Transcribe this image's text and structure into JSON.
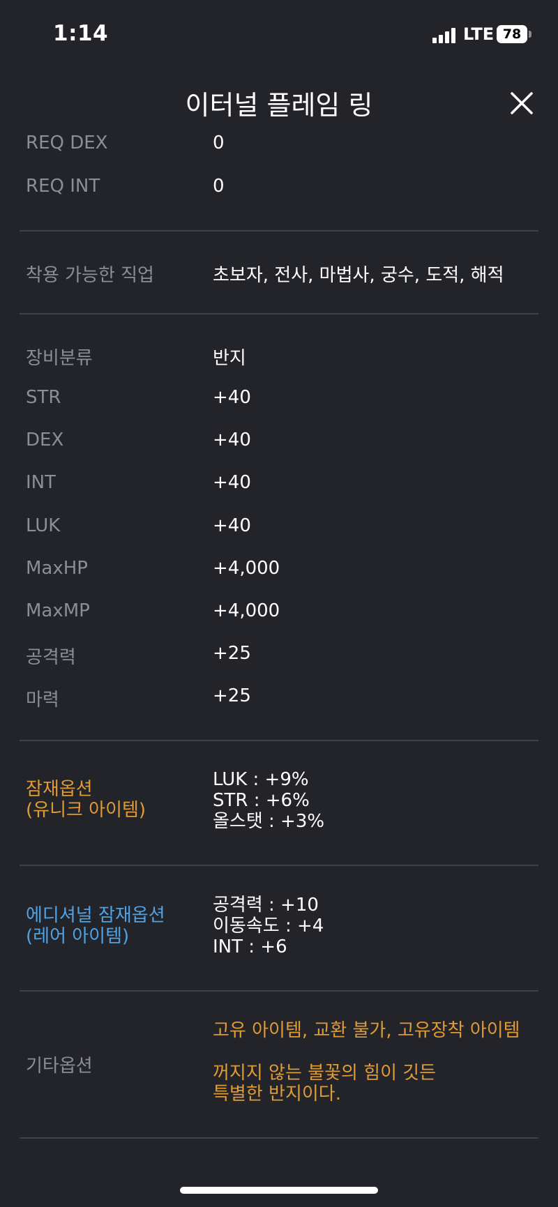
{
  "status_bar": {
    "time": "1:14",
    "network": "LTE",
    "battery": "78"
  },
  "header": {
    "title": "이터널 플레임 링",
    "close_icon": "close-icon"
  },
  "req": [
    {
      "label": "REQ DEX",
      "value": "0"
    },
    {
      "label": "REQ INT",
      "value": "0"
    }
  ],
  "jobs": {
    "label": "착용 가능한 직업",
    "value": "초보자, 전사, 마법사, 궁수, 도적, 해적"
  },
  "stats": [
    {
      "label": "장비분류",
      "value": "반지"
    },
    {
      "label": "STR",
      "value": "+40"
    },
    {
      "label": "DEX",
      "value": "+40"
    },
    {
      "label": "INT",
      "value": "+40"
    },
    {
      "label": "LUK",
      "value": "+40"
    },
    {
      "label": "MaxHP",
      "value": "+4,000"
    },
    {
      "label": "MaxMP",
      "value": "+4,000"
    },
    {
      "label": "공격력",
      "value": "+25"
    },
    {
      "label": "마력",
      "value": "+25"
    }
  ],
  "potential": {
    "label_line1": "잠재옵션",
    "label_line2": "(유니크 아이템)",
    "label_color": "#e09a36",
    "lines": [
      "LUK : +9%",
      "STR : +6%",
      "올스탯 : +3%"
    ]
  },
  "additional_potential": {
    "label_line1": "에디셔널 잠재옵션",
    "label_line2": "(레어 아이템)",
    "label_color": "#4ea3e6",
    "lines": [
      "공격력 : +10",
      "이동속도 : +4",
      "INT : +6"
    ]
  },
  "other": {
    "label": "기타옵션",
    "line1": "고유 아이템, 교환 불가, 고유장착 아이템",
    "desc_line1": "꺼지지 않는 불꽃의 힘이 깃든",
    "desc_line2": "특별한 반지이다.",
    "text_color": "#e09a36"
  }
}
